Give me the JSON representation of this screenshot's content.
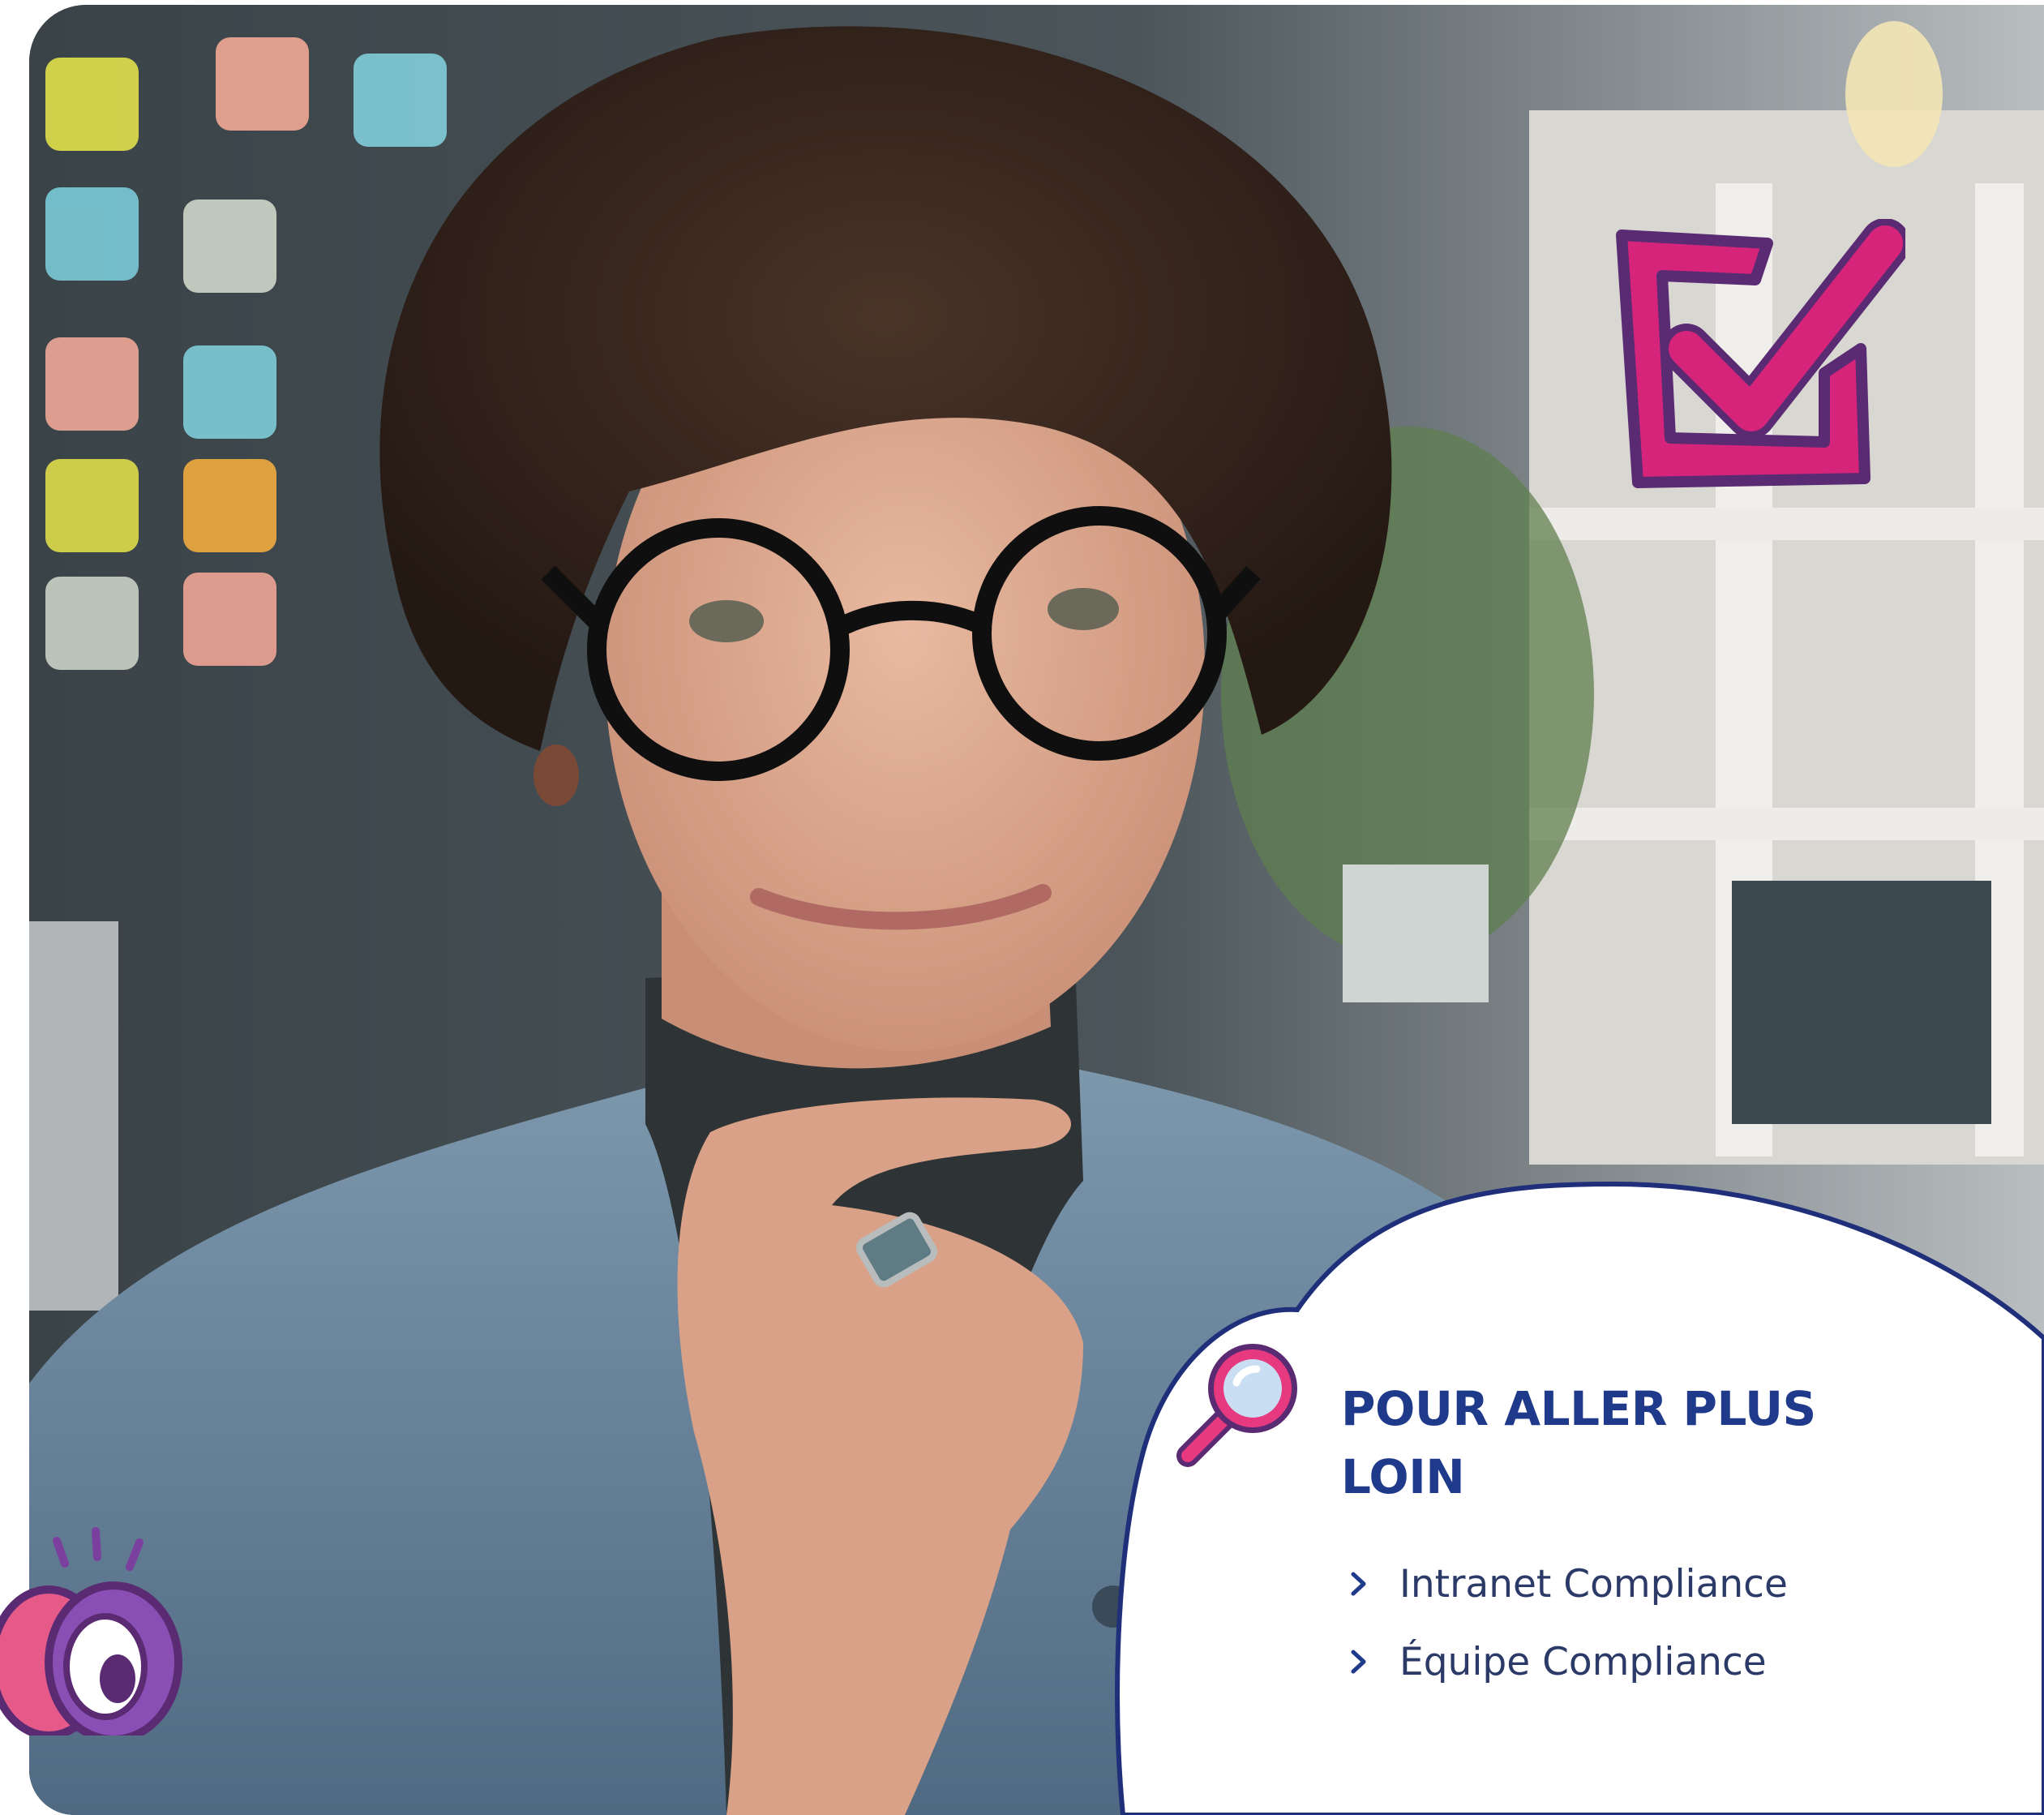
{
  "info_box": {
    "title": "POUR ALLER PLUS LOIN",
    "links": [
      {
        "label": "Intranet Compliance"
      },
      {
        "label": "Équipe Compliance"
      }
    ]
  },
  "icons": [
    "magnifier-icon",
    "checkbox-check-icon",
    "binoculars-icon",
    "chevron-right-icon"
  ],
  "colors": {
    "title": "#1f3a8a",
    "link_text": "#2b3a67",
    "bubble_border": "#1f2f7a",
    "accent_pink": "#d6247a",
    "accent_purple": "#7b3f9e"
  }
}
